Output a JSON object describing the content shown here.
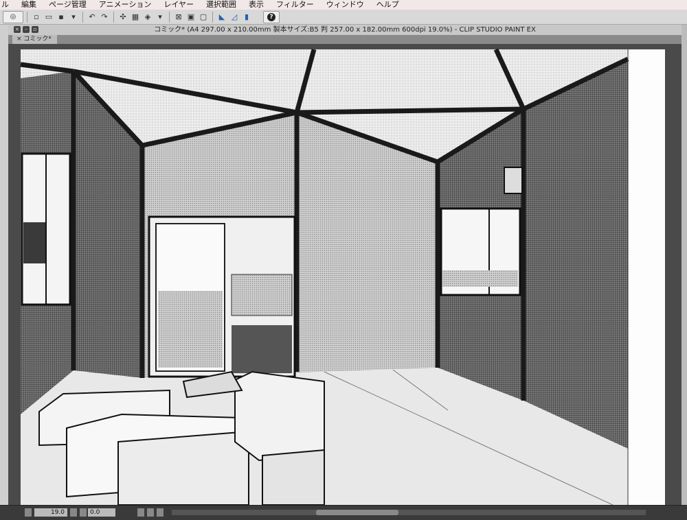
{
  "menu": {
    "items": [
      "ル",
      "編集",
      "ページ管理",
      "アニメーション",
      "レイヤー",
      "選択範囲",
      "表示",
      "フィルター",
      "ウィンドウ",
      "ヘルプ"
    ]
  },
  "toolbar": {
    "help_label": "?"
  },
  "window": {
    "title": "コミック* (A4 297.00 x 210.00mm 製本サイズ:B5 判 257.00 x 182.00mm 600dpi 19.0%)  - CLIP STUDIO PAINT EX"
  },
  "document_tab": {
    "label": "コミック*"
  },
  "status": {
    "zoom": "19.0",
    "angle": "0.0"
  },
  "colors": {
    "menubar_bg": "#f2e8e8",
    "toolbar_bg": "#d8d8d8",
    "canvas_bg": "#4a4a4a",
    "paper": "#fdfdfd"
  }
}
